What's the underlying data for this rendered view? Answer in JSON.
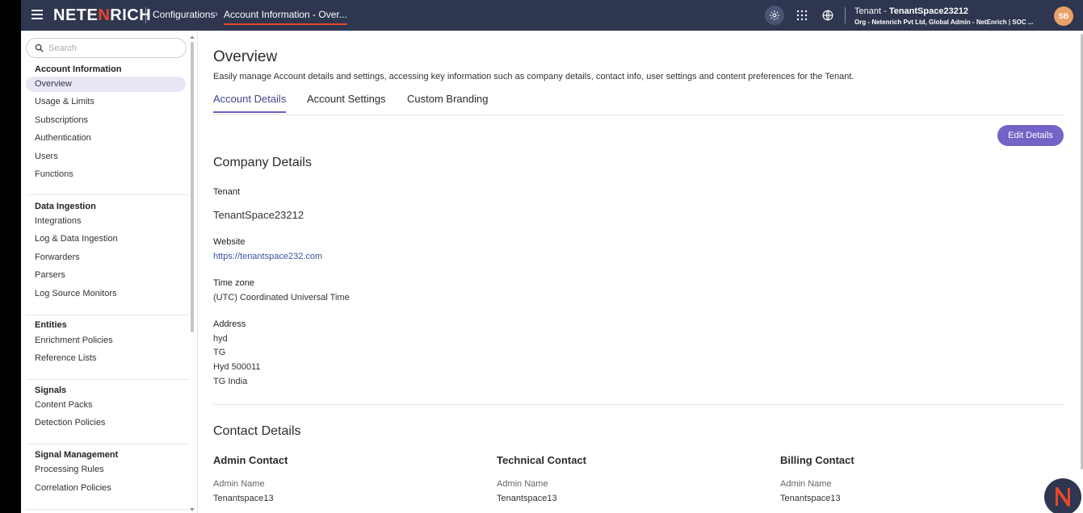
{
  "topbar": {
    "brand": {
      "part1": "NETE",
      "part2": "N",
      "part3": "RICH"
    },
    "breadcrumbs": [
      "Configurations",
      "Account Information - Over..."
    ],
    "tenant_prefix": "Tenant - ",
    "tenant_name": "TenantSpace23212",
    "org_line": "Org - Netenrich Pvt Ltd, Global Admin - NetEnrich | SOC ...",
    "avatar_initials": "SB"
  },
  "sidebar": {
    "search_placeholder": "Search",
    "groups": [
      {
        "title": "Account Information",
        "items": [
          "Overview",
          "Usage & Limits",
          "Subscriptions",
          "Authentication",
          "Users",
          "Functions"
        ]
      },
      {
        "title": "Data Ingestion",
        "items": [
          "Integrations",
          "Log & Data Ingestion",
          "Forwarders",
          "Parsers",
          "Log Source Monitors"
        ]
      },
      {
        "title": "Entities",
        "items": [
          "Enrichment Policies",
          "Reference Lists"
        ]
      },
      {
        "title": "Signals",
        "items": [
          "Content Packs",
          "Detection Policies"
        ]
      },
      {
        "title": "Signal Management",
        "items": [
          "Processing Rules",
          "Correlation Policies"
        ]
      }
    ],
    "active_item": "Overview"
  },
  "main": {
    "title": "Overview",
    "description": "Easily manage Account details and settings, accessing key information such as company details, contact info, user settings and content preferences for the Tenant.",
    "tabs": [
      "Account Details",
      "Account Settings",
      "Custom Branding"
    ],
    "active_tab": "Account Details",
    "edit_button": "Edit Details",
    "company": {
      "title": "Company Details",
      "tenant_label": "Tenant",
      "tenant_value": "TenantSpace23212",
      "website_label": "Website",
      "website_value": "https://tenantspace232.com",
      "timezone_label": "Time zone",
      "timezone_value": "(UTC) Coordinated Universal Time",
      "address_label": "Address",
      "address_lines": [
        "hyd",
        "TG",
        "Hyd 500011",
        "TG India"
      ]
    },
    "contacts": {
      "title": "Contact Details",
      "columns": [
        {
          "heading": "Admin Contact",
          "label": "Admin Name",
          "value": "Tenantspace13"
        },
        {
          "heading": "Technical Contact",
          "label": "Admin Name",
          "value": "Tenantspace13"
        },
        {
          "heading": "Billing Contact",
          "label": "Admin Name",
          "value": "Tenantspace13"
        }
      ]
    }
  },
  "colors": {
    "topbar": "#2e3650",
    "accent": "#7563c7",
    "brand_accent": "#e8462a"
  },
  "icons": [
    "menu-icon",
    "search-icon",
    "gear-icon",
    "apps-grid-icon",
    "globe-icon",
    "netenrich-logo-icon"
  ]
}
